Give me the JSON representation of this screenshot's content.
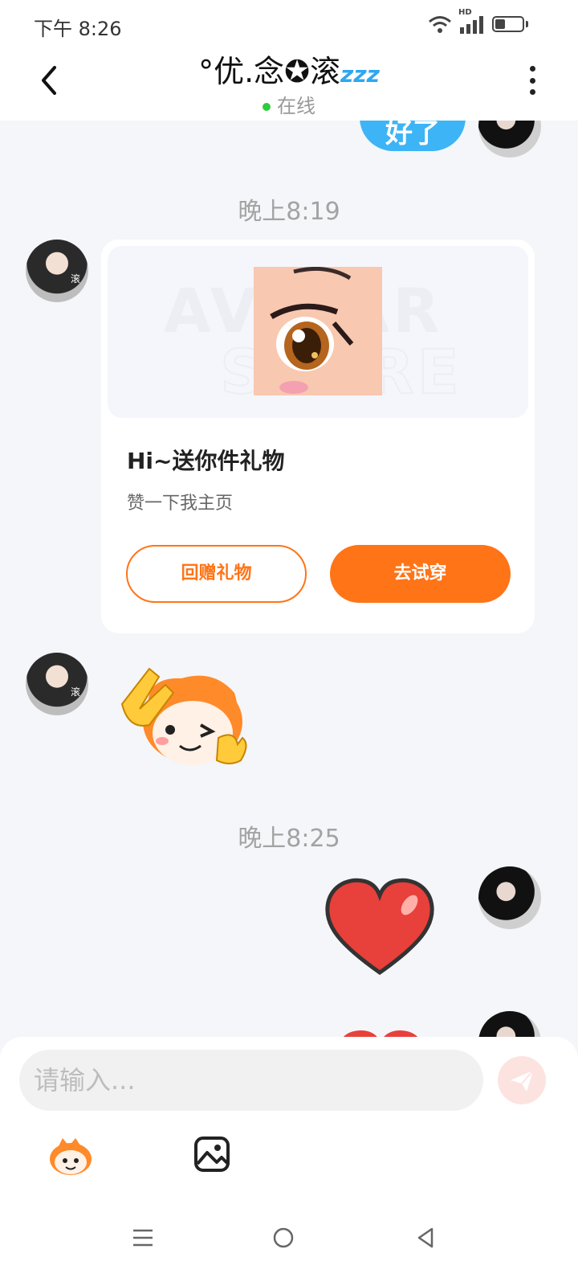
{
  "status_bar": {
    "time": "下午 8:26",
    "hd_label": "HD",
    "icons": [
      "wifi-icon",
      "signal-icon",
      "battery-icon"
    ]
  },
  "header": {
    "contact_name": "°优.念✪滚",
    "contact_name_suffix": "zzz",
    "status": "在线",
    "icons": [
      "back-icon",
      "more-icon"
    ]
  },
  "chat": {
    "partial_bubble_text": "好了",
    "time_1": "晚上8:19",
    "gift_card": {
      "title": "Hi~送你件礼物",
      "subtitle": "赞一下我主页",
      "return_gift_label": "回赠礼物",
      "try_on_label": "去试穿",
      "watermark": "AVATAR STORE"
    },
    "time_2": "晚上8:25",
    "avatar_tag": "滚",
    "stickers": [
      "peace-sign-sticker",
      "heart-sticker"
    ]
  },
  "composer": {
    "placeholder": "请输入...",
    "icons": [
      "send-icon",
      "emoji-icon",
      "image-icon"
    ]
  },
  "colors": {
    "accent_orange": "#ff7417",
    "bubble_blue": "#3db4f6",
    "online_green": "#2ecc40",
    "background": "#f4f6f9"
  },
  "nav": {
    "icons": [
      "menu-icon",
      "home-icon",
      "back-nav-icon"
    ]
  }
}
